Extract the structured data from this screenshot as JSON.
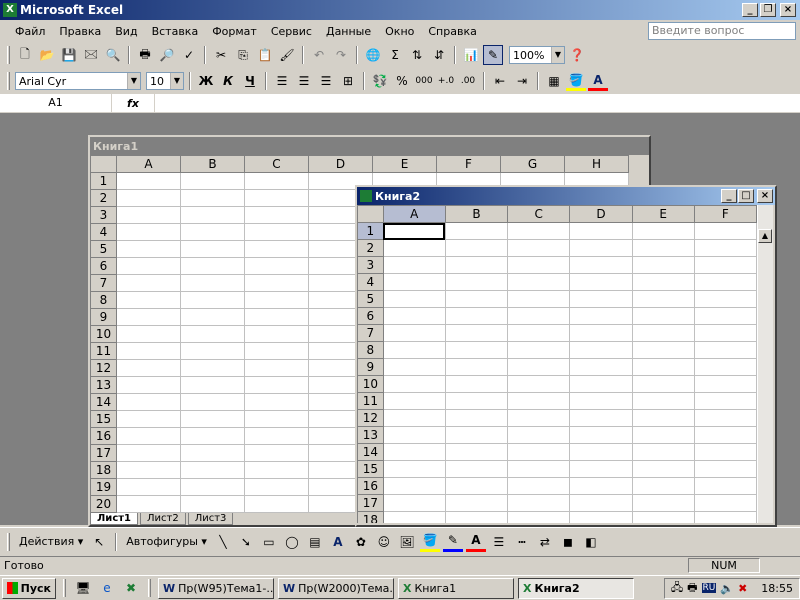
{
  "app": {
    "title": "Microsoft Excel"
  },
  "menu": [
    "Файл",
    "Правка",
    "Вид",
    "Вставка",
    "Формат",
    "Сервис",
    "Данные",
    "Окно",
    "Справка"
  ],
  "ask_placeholder": "Введите вопрос",
  "toolbar": {
    "zoom": "100%"
  },
  "format": {
    "font": "Arial Cyr",
    "size": "10",
    "bold": "Ж",
    "italic": "К",
    "underline": "Ч",
    "percent": "%",
    "thousands": "000"
  },
  "formula_bar": {
    "cell_ref": "A1",
    "fx": "fx"
  },
  "book1": {
    "title": "Книга1",
    "columns": [
      "A",
      "B",
      "C",
      "D",
      "E",
      "F",
      "G",
      "H"
    ],
    "rows": [
      "1",
      "2",
      "3",
      "4",
      "5",
      "6",
      "7",
      "8",
      "9",
      "10",
      "11",
      "12",
      "13",
      "14",
      "15",
      "16",
      "17",
      "18",
      "19",
      "20"
    ],
    "tabs": [
      "Лист1",
      "Лист2",
      "Лист3"
    ]
  },
  "book2": {
    "title": "Книга2",
    "columns": [
      "A",
      "B",
      "C",
      "D",
      "E",
      "F"
    ],
    "rows": [
      "1",
      "2",
      "3",
      "4",
      "5",
      "6",
      "7",
      "8",
      "9",
      "10",
      "11",
      "12",
      "13",
      "14",
      "15",
      "16",
      "17",
      "18"
    ]
  },
  "drawing": {
    "actions": "Действия",
    "autoshapes": "Автофигуры"
  },
  "status": {
    "ready": "Готово",
    "num": "NUM"
  },
  "taskbar": {
    "start": "Пуск",
    "tasks": [
      "Пр(W95)Тема1-...",
      "Пр(W2000)Тема...",
      "Книга1",
      "Книга2"
    ],
    "lang": "RU",
    "clock": "18:55"
  }
}
